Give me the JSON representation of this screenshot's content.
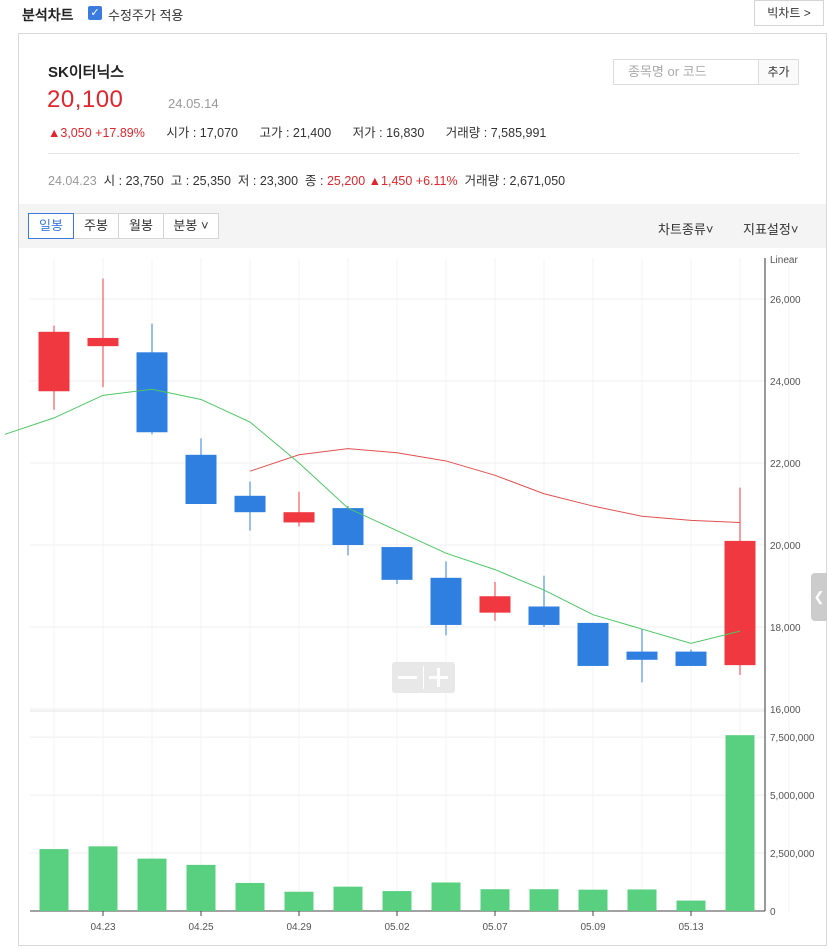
{
  "header": {
    "title": "분석차트",
    "adjusted_label": "수정주가 적용",
    "big_chart_button": "빅차트 >"
  },
  "stock": {
    "name": "SK이터닉스",
    "price": "20,100",
    "date": "24.05.14",
    "change": "▲3,050",
    "change_pct": "+17.89%",
    "open_label": "시가",
    "open": "17,070",
    "high_label": "고가",
    "high": "21,400",
    "low_label": "저가",
    "low": "16,830",
    "volume_label": "거래량",
    "volume": "7,585,991"
  },
  "search": {
    "placeholder": "종목명 or 코드",
    "add_label": "추가"
  },
  "hover": {
    "date": "24.04.23",
    "open_label": "시",
    "open": "23,750",
    "high_label": "고",
    "high": "25,350",
    "low_label": "저",
    "low": "23,300",
    "close_label": "종",
    "close": "25,200",
    "change": "▲1,450",
    "change_pct": "+6.11%",
    "volume_label": "거래량",
    "volume": "2,671,050"
  },
  "tabs": [
    "일봉",
    "주봉",
    "월봉",
    "분봉"
  ],
  "menus": {
    "chart_type": "차트종류",
    "indicator": "지표설정"
  },
  "colors": {
    "up": "#f03840",
    "down": "#2f7fe0",
    "ma_short": "#4cc864",
    "ma_long": "#e05050",
    "volume": "#58d080"
  },
  "chart_data": {
    "type": "candlestick",
    "scale_label": "Linear",
    "x_tick_labels": [
      "04.23",
      "04.25",
      "04.29",
      "05.02",
      "05.07",
      "05.09",
      "05.13"
    ],
    "x_tick_indices": [
      1,
      3,
      5,
      7,
      9,
      11,
      13
    ],
    "price_axis": {
      "ylim": [
        16000,
        27000
      ],
      "ticks": [
        16000,
        18000,
        20000,
        22000,
        24000,
        26000
      ],
      "tick_labels": [
        "16,000",
        "18,000",
        "20,000",
        "22,000",
        "24,000",
        "26,000"
      ]
    },
    "volume_axis": {
      "ylim": [
        0,
        8500000
      ],
      "ticks": [
        0,
        2500000,
        5000000,
        7500000
      ],
      "tick_labels": [
        "0",
        "2,500,000",
        "5,000,000",
        "7,500,000"
      ]
    },
    "candles": [
      {
        "open": 23750,
        "high": 25350,
        "low": 23300,
        "close": 25200
      },
      {
        "open": 24850,
        "high": 26500,
        "low": 23850,
        "close": 25050
      },
      {
        "open": 24700,
        "high": 25400,
        "low": 22700,
        "close": 22750
      },
      {
        "open": 22200,
        "high": 22600,
        "low": 21000,
        "close": 21000
      },
      {
        "open": 21200,
        "high": 21550,
        "low": 20350,
        "close": 20800
      },
      {
        "open": 20550,
        "high": 21300,
        "low": 20450,
        "close": 20800
      },
      {
        "open": 20900,
        "high": 20950,
        "low": 19750,
        "close": 20000
      },
      {
        "open": 19950,
        "high": 19950,
        "low": 19050,
        "close": 19150
      },
      {
        "open": 19200,
        "high": 19600,
        "low": 17800,
        "close": 18050
      },
      {
        "open": 18350,
        "high": 19100,
        "low": 18150,
        "close": 18750
      },
      {
        "open": 18500,
        "high": 19250,
        "low": 18000,
        "close": 18050
      },
      {
        "open": 18100,
        "high": 18100,
        "low": 17050,
        "close": 17050
      },
      {
        "open": 17400,
        "high": 17950,
        "low": 16650,
        "close": 17200
      },
      {
        "open": 17400,
        "high": 17450,
        "low": 17050,
        "close": 17050
      },
      {
        "open": 17070,
        "high": 21400,
        "low": 16830,
        "close": 20100
      }
    ],
    "ma_short": [
      22700,
      23100,
      23650,
      23800,
      23550,
      23000,
      22000,
      20900,
      20350,
      19800,
      19400,
      18900,
      18300,
      17950,
      17600,
      17900
    ],
    "ma_short_start": -1,
    "ma_long": [
      21800,
      22200,
      22350,
      22250,
      22050,
      21700,
      21250,
      20950,
      20700,
      20600,
      20550
    ],
    "ma_long_start": 4,
    "volumes": [
      2671050,
      2790000,
      2260000,
      1990000,
      1210000,
      830000,
      1050000,
      860000,
      1230000,
      940000,
      940000,
      920000,
      930000,
      450000,
      7585991
    ]
  }
}
